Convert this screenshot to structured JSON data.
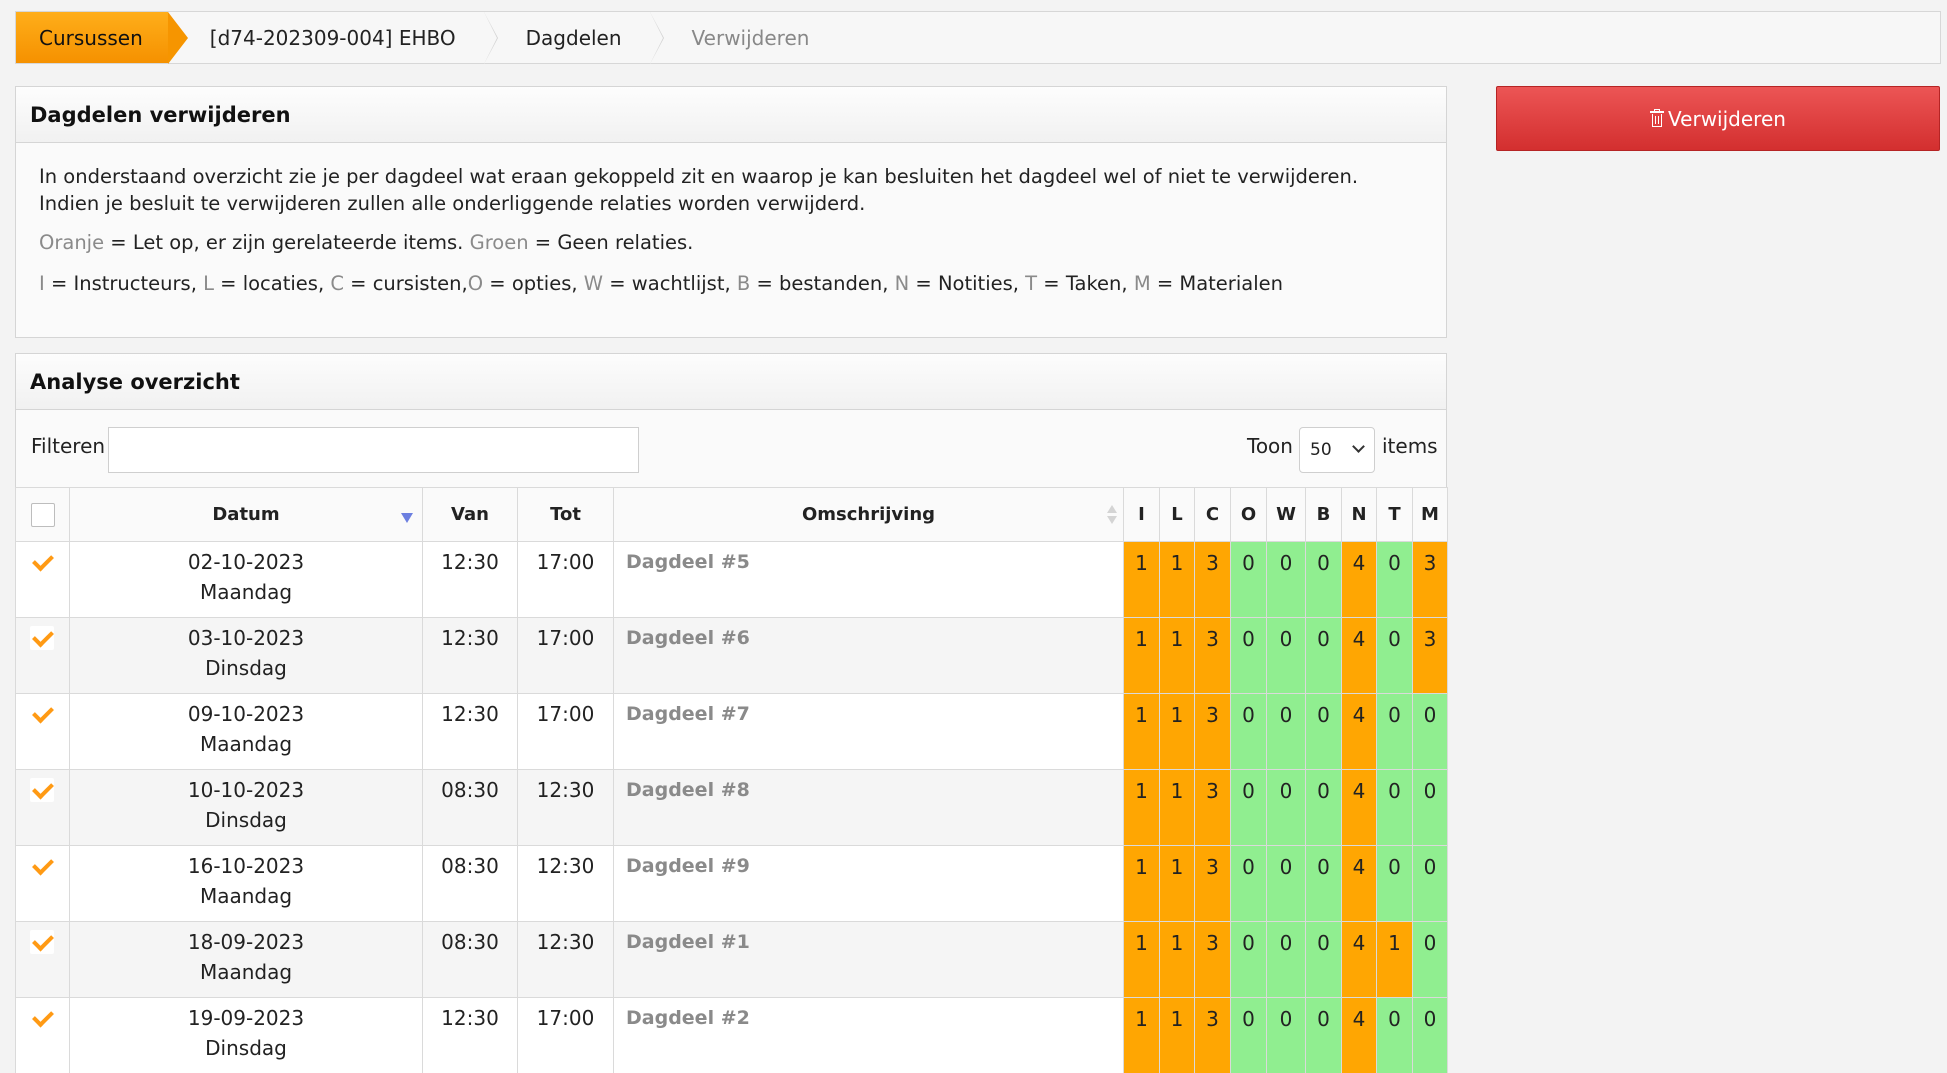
{
  "breadcrumb": [
    {
      "label": "Cursussen"
    },
    {
      "label": "[d74-202309-004] EHBO"
    },
    {
      "label": "Dagdelen"
    },
    {
      "label": "Verwijderen"
    }
  ],
  "actions": {
    "delete_label": "Verwijderen",
    "delete_icon": "trash-icon"
  },
  "info_panel": {
    "title": "Dagdelen verwijderen",
    "intro": "In onderstaand overzicht zie je per dagdeel wat eraan gekoppeld zit en waarop je kan besluiten het dagdeel wel of niet te verwijderen. Indien je besluit te verwijderen zullen alle onderliggende relaties worden verwijderd.",
    "legend_color": {
      "orange_word": "Oranje",
      "orange_text": " = Let op, er zijn gerelateerde items. ",
      "green_word": "Groen",
      "green_text": " = Geen relaties."
    },
    "legend_codes": [
      {
        "code": "I",
        "text": " = Instructeurs, "
      },
      {
        "code": "L",
        "text": " = locaties, "
      },
      {
        "code": "C",
        "text": " = cursisten,"
      },
      {
        "code": "O",
        "text": " = opties, "
      },
      {
        "code": "W",
        "text": " = wachtlijst, "
      },
      {
        "code": "B",
        "text": " = bestanden, "
      },
      {
        "code": "N",
        "text": " = Notities, "
      },
      {
        "code": "T",
        "text": " = Taken, "
      },
      {
        "code": "M",
        "text": " = Materialen"
      }
    ]
  },
  "analyse_panel": {
    "title": "Analyse overzicht",
    "filter_label": "Filteren",
    "filter_value": "",
    "show_label": "Toon",
    "show_value": "50",
    "items_label": "items",
    "columns": {
      "datum": "Datum",
      "van": "Van",
      "tot": "Tot",
      "omschrijving": "Omschrijving",
      "codes": [
        "I",
        "L",
        "C",
        "O",
        "W",
        "B",
        "N",
        "T",
        "M"
      ]
    },
    "rows": [
      {
        "date": "02-10-2023",
        "day": "Maandag",
        "van": "12:30",
        "tot": "17:00",
        "desc": "Dagdeel #5",
        "counts": [
          "1",
          "1",
          "3",
          "0",
          "0",
          "0",
          "4",
          "0",
          "3"
        ]
      },
      {
        "date": "03-10-2023",
        "day": "Dinsdag",
        "van": "12:30",
        "tot": "17:00",
        "desc": "Dagdeel #6",
        "counts": [
          "1",
          "1",
          "3",
          "0",
          "0",
          "0",
          "4",
          "0",
          "3"
        ]
      },
      {
        "date": "09-10-2023",
        "day": "Maandag",
        "van": "12:30",
        "tot": "17:00",
        "desc": "Dagdeel #7",
        "counts": [
          "1",
          "1",
          "3",
          "0",
          "0",
          "0",
          "4",
          "0",
          "0"
        ]
      },
      {
        "date": "10-10-2023",
        "day": "Dinsdag",
        "van": "08:30",
        "tot": "12:30",
        "desc": "Dagdeel #8",
        "counts": [
          "1",
          "1",
          "3",
          "0",
          "0",
          "0",
          "4",
          "0",
          "0"
        ]
      },
      {
        "date": "16-10-2023",
        "day": "Maandag",
        "van": "08:30",
        "tot": "12:30",
        "desc": "Dagdeel #9",
        "counts": [
          "1",
          "1",
          "3",
          "0",
          "0",
          "0",
          "4",
          "0",
          "0"
        ]
      },
      {
        "date": "18-09-2023",
        "day": "Maandag",
        "van": "08:30",
        "tot": "12:30",
        "desc": "Dagdeel #1",
        "counts": [
          "1",
          "1",
          "3",
          "0",
          "0",
          "0",
          "4",
          "1",
          "0"
        ]
      },
      {
        "date": "19-09-2023",
        "day": "Dinsdag",
        "van": "12:30",
        "tot": "17:00",
        "desc": "Dagdeel #2",
        "counts": [
          "1",
          "1",
          "3",
          "0",
          "0",
          "0",
          "4",
          "0",
          "0"
        ]
      }
    ]
  },
  "colors": {
    "orange": "#ffa602",
    "green": "#90ee90",
    "accent": "#f59100",
    "danger": "#d32f2f"
  }
}
